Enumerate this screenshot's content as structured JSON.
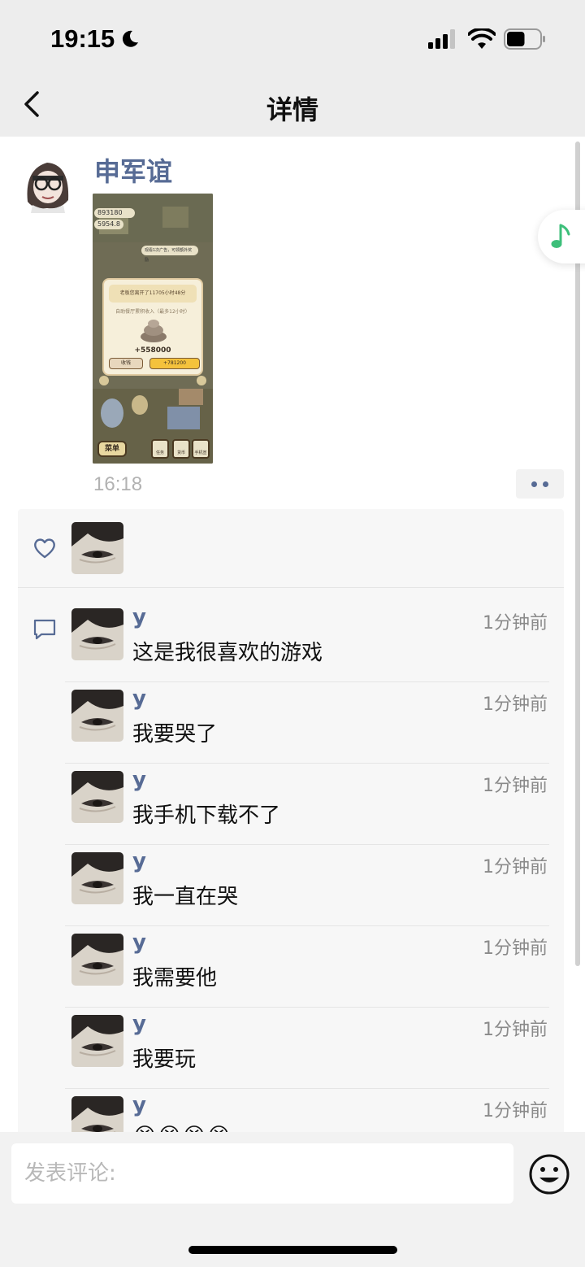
{
  "status_bar": {
    "time": "19:15",
    "battery_level": 0.55
  },
  "nav": {
    "title": "详情"
  },
  "post": {
    "author": "申军谊",
    "time": "16:18",
    "image": {
      "stat_coins": "893180",
      "stat_rate": "5954.8",
      "ad_tip": "观看1次广告，可领额外奖励",
      "dialog_title": "老板您离开了11705小时48分",
      "dialog_sub": "自助餐厅累积收入（最多12小时）",
      "amount": "+558000",
      "collect": "收钱",
      "double": "+781200",
      "menu": "菜单",
      "tasks": "任务",
      "shop": "货币x13",
      "phone": "手机宣传"
    }
  },
  "comments": [
    {
      "name": "y",
      "time": "1分钟前",
      "text": "这是我很喜欢的游戏"
    },
    {
      "name": "y",
      "time": "1分钟前",
      "text": "我要哭了"
    },
    {
      "name": "y",
      "time": "1分钟前",
      "text": "我手机下载不了"
    },
    {
      "name": "y",
      "time": "1分钟前",
      "text": "我一直在哭"
    },
    {
      "name": "y",
      "time": "1分钟前",
      "text": "我需要他"
    },
    {
      "name": "y",
      "time": "1分钟前",
      "text": "我要玩"
    },
    {
      "name": "y",
      "time": "1分钟前",
      "text": "😭😭😭😭"
    }
  ],
  "input": {
    "placeholder": "发表评论:"
  },
  "colors": {
    "accent_link": "#576b95",
    "music_green": "#3dbf7a"
  }
}
